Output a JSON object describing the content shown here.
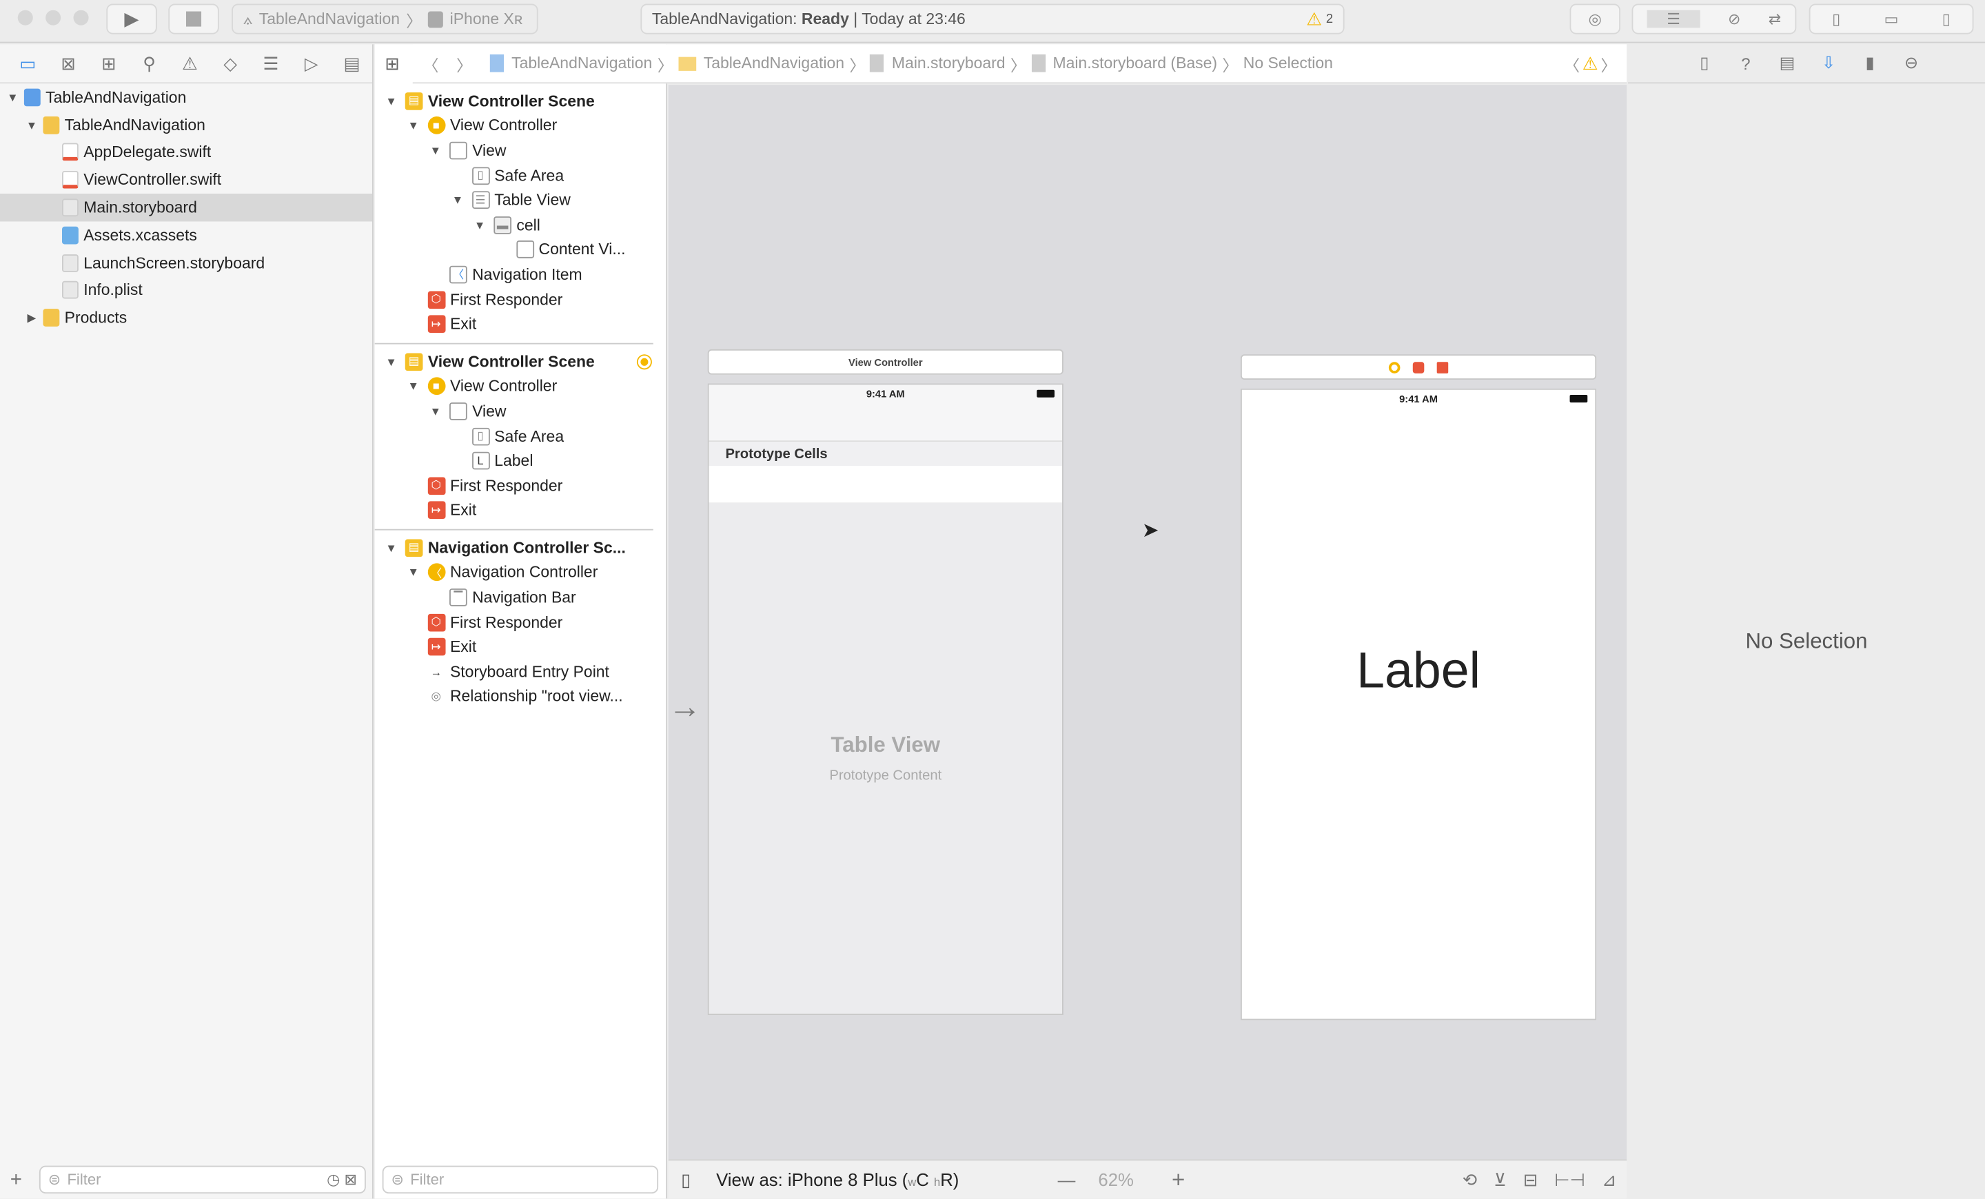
{
  "toolbar": {
    "scheme": "TableAndNavigation",
    "device": "iPhone Xʀ",
    "status_project": "TableAndNavigation:",
    "status_state": "Ready",
    "status_time": "| Today at 23:46",
    "warnings": "2",
    "icons": [
      "play-icon",
      "stop-icon",
      "library-icon",
      "standard-editor-icon",
      "assistant-editor-icon",
      "version-editor-icon",
      "navigator-toggle-icon",
      "debug-toggle-icon",
      "inspector-toggle-icon"
    ]
  },
  "navigator": {
    "icons": [
      "folder-icon",
      "source-control-icon",
      "symbol-icon",
      "find-icon",
      "issue-icon",
      "test-icon",
      "debug-icon",
      "breakpoint-icon",
      "report-icon"
    ],
    "items": [
      {
        "label": "TableAndNavigation",
        "level": 0,
        "expanded": true,
        "icon": "project",
        "selected": false
      },
      {
        "label": "TableAndNavigation",
        "level": 1,
        "expanded": true,
        "icon": "folder",
        "selected": false
      },
      {
        "label": "AppDelegate.swift",
        "level": 2,
        "icon": "swift",
        "selected": false
      },
      {
        "label": "ViewController.swift",
        "level": 2,
        "icon": "swift",
        "selected": false
      },
      {
        "label": "Main.storyboard",
        "level": 2,
        "icon": "storyboard",
        "selected": true
      },
      {
        "label": "Assets.xcassets",
        "level": 2,
        "icon": "assets",
        "selected": false
      },
      {
        "label": "LaunchScreen.storyboard",
        "level": 2,
        "icon": "storyboard",
        "selected": false
      },
      {
        "label": "Info.plist",
        "level": 2,
        "icon": "plist",
        "selected": false
      },
      {
        "label": "Products",
        "level": 1,
        "expanded": false,
        "icon": "folder",
        "selected": false
      }
    ],
    "filter_placeholder": "Filter"
  },
  "jumpbar": {
    "items": [
      "TableAndNavigation",
      "TableAndNavigation",
      "Main.storyboard",
      "Main.storyboard (Base)",
      "No Selection"
    ]
  },
  "outline": {
    "sections": [
      {
        "rows": [
          {
            "label": "View Controller Scene",
            "level": 0,
            "arrow": true,
            "icon": "scene",
            "bold": true
          },
          {
            "label": "View Controller",
            "level": 1,
            "arrow": true,
            "icon": "vc"
          },
          {
            "label": "View",
            "level": 2,
            "arrow": true,
            "icon": "view"
          },
          {
            "label": "Safe Area",
            "level": 3,
            "icon": "safe"
          },
          {
            "label": "Table View",
            "level": 3,
            "arrow": true,
            "icon": "table"
          },
          {
            "label": "cell",
            "level": 4,
            "arrow": true,
            "icon": "cell"
          },
          {
            "label": "Content Vi...",
            "level": 5,
            "icon": "view"
          },
          {
            "label": "Navigation Item",
            "level": 2,
            "icon": "navitem"
          },
          {
            "label": "First Responder",
            "level": 1,
            "icon": "responder"
          },
          {
            "label": "Exit",
            "level": 1,
            "icon": "exit"
          }
        ]
      },
      {
        "rows": [
          {
            "label": "View Controller Scene",
            "level": 0,
            "arrow": true,
            "icon": "scene",
            "bold": true,
            "dot": true
          },
          {
            "label": "View Controller",
            "level": 1,
            "arrow": true,
            "icon": "vc"
          },
          {
            "label": "View",
            "level": 2,
            "arrow": true,
            "icon": "view"
          },
          {
            "label": "Safe Area",
            "level": 3,
            "icon": "safe"
          },
          {
            "label": "Label",
            "level": 3,
            "icon": "label"
          },
          {
            "label": "First Responder",
            "level": 1,
            "icon": "responder"
          },
          {
            "label": "Exit",
            "level": 1,
            "icon": "exit"
          }
        ]
      },
      {
        "rows": [
          {
            "label": "Navigation Controller Sc...",
            "level": 0,
            "arrow": true,
            "icon": "scene",
            "bold": true
          },
          {
            "label": "Navigation Controller",
            "level": 1,
            "arrow": true,
            "icon": "navctrl"
          },
          {
            "label": "Navigation Bar",
            "level": 2,
            "icon": "navbar"
          },
          {
            "label": "First Responder",
            "level": 1,
            "icon": "responder"
          },
          {
            "label": "Exit",
            "level": 1,
            "icon": "exit"
          },
          {
            "label": "Storyboard Entry Point",
            "level": 1,
            "icon": "entry"
          },
          {
            "label": "Relationship \"root view...",
            "level": 1,
            "icon": "relationship"
          }
        ]
      }
    ],
    "filter_placeholder": "Filter"
  },
  "canvas": {
    "scene1": {
      "title": "View Controller",
      "time": "9:41 AM",
      "prototype_cells": "Prototype Cells",
      "table_view": "Table View",
      "prototype_content": "Prototype Content"
    },
    "scene2": {
      "time": "9:41 AM",
      "label": "Label"
    }
  },
  "bottombar": {
    "view_as": "View as: iPhone 8 Plus (",
    "w": "w",
    "c": "C ",
    "h": "h",
    "r": "R)",
    "zoom": "62%"
  },
  "inspector": {
    "empty": "No Selection",
    "icons": [
      "file-icon",
      "help-icon",
      "identity-icon",
      "attributes-icon",
      "size-icon",
      "connections-icon"
    ]
  },
  "colors": {
    "accent": "#3d8ee8",
    "warning": "#f5b800",
    "scene": "#f5c026",
    "exit": "#e8553a"
  }
}
